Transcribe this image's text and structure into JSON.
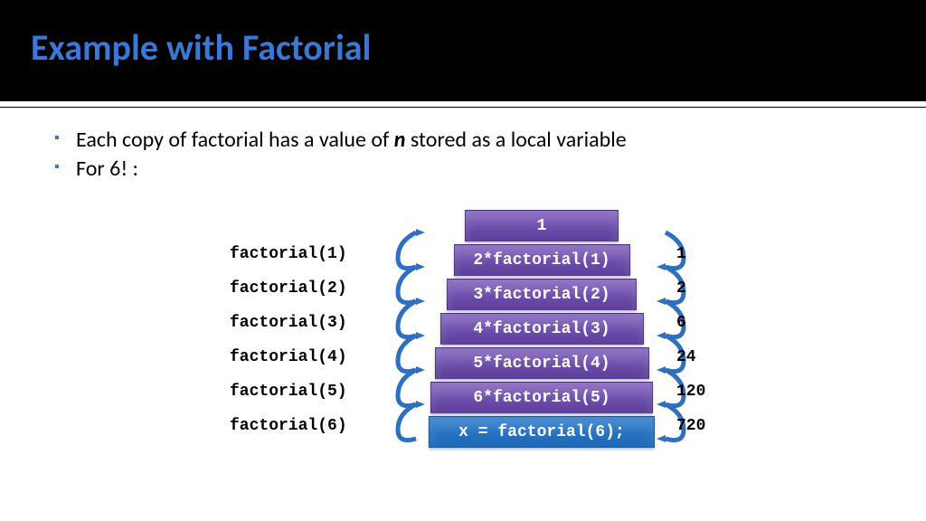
{
  "title": "Example with Factorial",
  "bullets": [
    {
      "prefix": "Each copy of factorial has a value of ",
      "bold": "n",
      "suffix": " stored as a local variable"
    },
    {
      "prefix": "For 6! :",
      "bold": "",
      "suffix": ""
    }
  ],
  "left_labels": [
    "factorial(1)",
    "factorial(2)",
    "factorial(3)",
    "factorial(4)",
    "factorial(5)",
    "factorial(6)"
  ],
  "right_values": [
    "1",
    "2",
    "6",
    "24",
    "120",
    "720"
  ],
  "stack": {
    "top": "1",
    "layers": [
      "2*factorial(1)",
      "3*factorial(2)",
      "4*factorial(3)",
      "5*factorial(4)",
      "6*factorial(5)"
    ],
    "bottom": "x = factorial(6);"
  }
}
